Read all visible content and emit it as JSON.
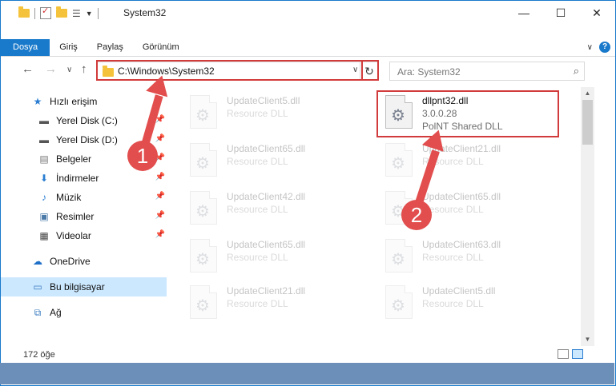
{
  "title": "System32",
  "window_controls": {
    "minimize": "—",
    "maximize": "☐",
    "close": "✕"
  },
  "ribbon": {
    "tabs": [
      "Dosya",
      "Giriş",
      "Paylaş",
      "Görünüm"
    ]
  },
  "address": {
    "path": "C:\\Windows\\System32",
    "dropdown": "∨",
    "refresh": "↻"
  },
  "search": {
    "placeholder": "Ara: System32"
  },
  "nav": {
    "back": "←",
    "forward": "→",
    "recent": "∨",
    "up": "↑"
  },
  "sidebar": {
    "items": [
      {
        "label": "Hızlı erişim",
        "icon": "star-icon"
      },
      {
        "label": "Yerel Disk (C:)",
        "icon": "drive-icon",
        "pinned": true
      },
      {
        "label": "Yerel Disk (D:)",
        "icon": "drive-icon",
        "pinned": true
      },
      {
        "label": "Belgeler",
        "icon": "documents-icon",
        "pinned": true
      },
      {
        "label": "İndirmeler",
        "icon": "download-icon",
        "pinned": true
      },
      {
        "label": "Müzik",
        "icon": "music-icon",
        "pinned": true
      },
      {
        "label": "Resimler",
        "icon": "pictures-icon",
        "pinned": true
      },
      {
        "label": "Videolar",
        "icon": "video-icon",
        "pinned": true
      },
      {
        "label": "OneDrive",
        "icon": "cloud-icon"
      },
      {
        "label": "Bu bilgisayar",
        "icon": "computer-icon",
        "selected": true
      },
      {
        "label": "Ağ",
        "icon": "network-icon"
      }
    ]
  },
  "files": {
    "highlighted": {
      "name": "dllpnt32.dll",
      "version": "3.0.0.28",
      "description": "PolNT Shared DLL"
    },
    "left_column": [
      {
        "name": "UpdateClient5.dll",
        "type": "Resource DLL"
      },
      {
        "name": "UpdateClient65.dll",
        "type": "Resource DLL"
      },
      {
        "name": "UpdateClient42.dll",
        "type": "Resource DLL"
      },
      {
        "name": "UpdateClient65.dll",
        "type": "Resource DLL"
      },
      {
        "name": "UpdateClient21.dll",
        "type": "Resource DLL"
      }
    ],
    "right_column": [
      {
        "name": "UpdateClient21.dll",
        "type": "Resource DLL"
      },
      {
        "name": "UpdateClient65.dll",
        "type": "Resource DLL"
      },
      {
        "name": "UpdateClient63.dll",
        "type": "Resource DLL"
      },
      {
        "name": "UpdateClient5.dll",
        "type": "Resource DLL"
      }
    ]
  },
  "status": {
    "count": "172 öğe"
  },
  "annotations": {
    "step1": "1",
    "step2": "2",
    "color": "#e24d4d"
  }
}
